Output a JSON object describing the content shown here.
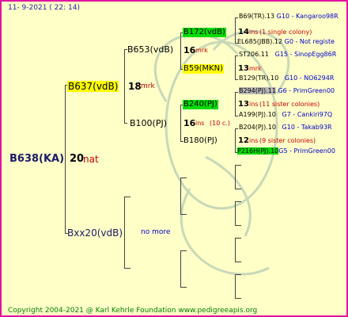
{
  "header": {
    "date": "11-  9-2021  (  22:  14)"
  },
  "footer": {
    "copyright": "Copyright 2004-2021 @ Karl Kehrle Foundation    www.pedigreeapis.org"
  },
  "root": {
    "name": "B638(KA)",
    "num": "20",
    "tag": "nat"
  },
  "gen1": {
    "top": {
      "name": "B637(vdB)",
      "num": "18",
      "tag": "mrk"
    },
    "bottom": {
      "name": "Bxx20(vdB)",
      "note": "no more"
    }
  },
  "gen2": {
    "a": {
      "name": "B653(vdB)",
      "num": "16",
      "tag": "mrk"
    },
    "b": {
      "name": "B100(PJ)",
      "num": "16",
      "tag": "ins",
      "extra": "(10 c.)"
    }
  },
  "gen3": {
    "a": {
      "name": "B172(vdB)",
      "num": "14",
      "tag": "ins",
      "note": "(1 single colony)"
    },
    "b": {
      "name": "B59(MKN)",
      "num": "13",
      "tag": "mrk"
    },
    "c": {
      "name": "B240(PJ)",
      "num": "13",
      "tag": "ins",
      "note": "(11 sister colonies)"
    },
    "d": {
      "name": "B180(PJ)",
      "num": "12",
      "tag": "ins",
      "note": "(9 sister colonies)"
    }
  },
  "gen4": {
    "a1": {
      "name": "B69(TR).13",
      "code": "G10",
      "loc": "Kangaroo98R"
    },
    "a2": {
      "name": "EL685(JBB).12",
      "code": "G0",
      "loc": "Not registe"
    },
    "b1": {
      "name": "ST206.11",
      "code": "G15",
      "loc": "SinopEgg86R"
    },
    "b2": {
      "name": "B129(TR).10",
      "code": "G10",
      "loc": "NO6294R"
    },
    "c1": {
      "name": "B294(PJ).11",
      "code": "G6",
      "loc": "PrimGreen00"
    },
    "c2": {
      "name": "A199(PJ).10",
      "code": "G7",
      "loc": "Cankiri97Q"
    },
    "d1": {
      "name": "B204(PJ).10",
      "code": "G10",
      "loc": "Takab93R"
    },
    "d2": {
      "name": "P216H(PJ).10",
      "code": "G5",
      "loc": "PrimGreen00"
    }
  }
}
